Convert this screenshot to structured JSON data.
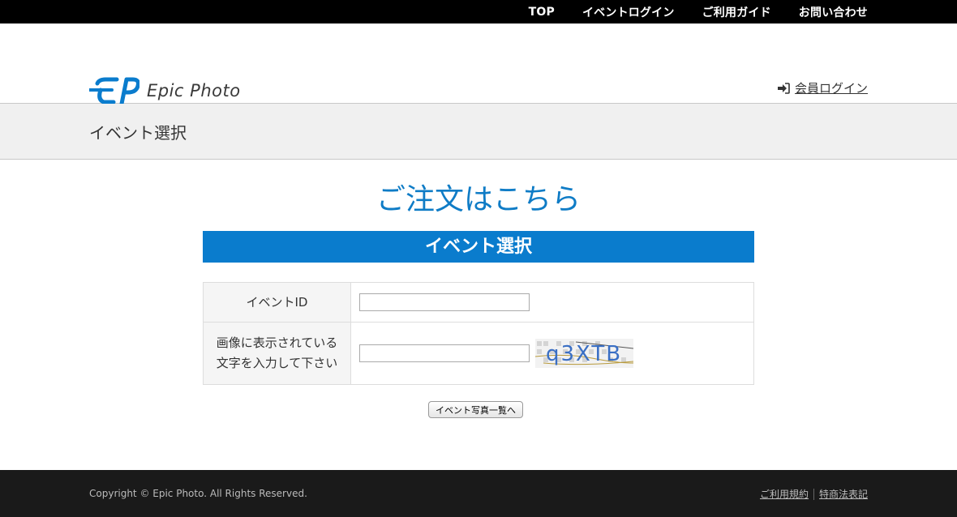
{
  "topnav": {
    "items": [
      "TOP",
      "イベントログイン",
      "ご利用ガイド",
      "お問い合わせ"
    ]
  },
  "header": {
    "logo_text": "Epic Photo",
    "member_login_label": "会員ログイン"
  },
  "page": {
    "title": "イベント選択"
  },
  "main": {
    "order_title": "ご注文はこちら",
    "section_title": "イベント選択",
    "form": {
      "event_id_label": "イベントID",
      "event_id_value": "",
      "captcha_label_line1": "画像に表示されている",
      "captcha_label_line2": "文字を入力して下さい",
      "captcha_value": "",
      "captcha_text": "q3XTB"
    },
    "submit_label": "イベント写真一覧へ"
  },
  "footer": {
    "copyright": "Copyright © Epic Photo. All Rights Reserved.",
    "links": [
      "ご利用規約",
      "特商法表記"
    ]
  },
  "colors": {
    "accent": "#0a7ccd",
    "title_blue": "#0f7cc6"
  }
}
